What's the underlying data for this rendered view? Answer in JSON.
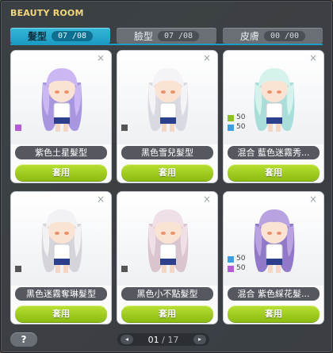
{
  "window": {
    "title": "BEAUTY ROOM"
  },
  "tabs": [
    {
      "label": "髮型",
      "count": "07 /08",
      "active": true
    },
    {
      "label": "臉型",
      "count": "07 /08",
      "active": false
    },
    {
      "label": "皮膚",
      "count": "00 /00",
      "active": false
    }
  ],
  "cards": [
    {
      "name": "紫色土星髮型",
      "apply_label": "套用",
      "close": "×",
      "swatches": [
        {
          "color": "#b45cd6",
          "pct": ""
        }
      ],
      "hair_color": "#cbb8f2",
      "hair_shade": "#a897e0"
    },
    {
      "name": "黑色雪兒髮型",
      "apply_label": "套用",
      "close": "×",
      "swatches": [
        {
          "color": "#555555",
          "pct": ""
        }
      ],
      "hair_color": "#f4f4f7",
      "hair_shade": "#d9d9e2"
    },
    {
      "name": "混合  藍色迷霧秀...",
      "apply_label": "套用",
      "close": "×",
      "swatches": [
        {
          "color": "#8cc21e",
          "pct": "50"
        },
        {
          "color": "#3d9fe0",
          "pct": "50"
        }
      ],
      "hair_color": "#d6f2ec",
      "hair_shade": "#a9ddd9"
    },
    {
      "name": "黑色迷霧奪琳髮型",
      "apply_label": "套用",
      "close": "×",
      "swatches": [
        {
          "color": "#555555",
          "pct": ""
        }
      ],
      "hair_color": "#f2f2f4",
      "hair_shade": "#d4d4da"
    },
    {
      "name": "黑色小不點髮型",
      "apply_label": "套用",
      "close": "×",
      "swatches": [
        {
          "color": "#555555",
          "pct": ""
        }
      ],
      "hair_color": "#eee0e6",
      "hair_shade": "#d9c4cf"
    },
    {
      "name": "混合  紫色綵花髮...",
      "apply_label": "套用",
      "close": "×",
      "swatches": [
        {
          "color": "#3d9fe0",
          "pct": "50"
        },
        {
          "color": "#b45cd6",
          "pct": "50"
        }
      ],
      "hair_color": "#b8a2e0",
      "hair_shade": "#9079c8"
    }
  ],
  "footer": {
    "help_label": "?",
    "prev_icon": "◂",
    "next_icon": "▸",
    "page_current": "01",
    "page_total": "/ 17"
  }
}
